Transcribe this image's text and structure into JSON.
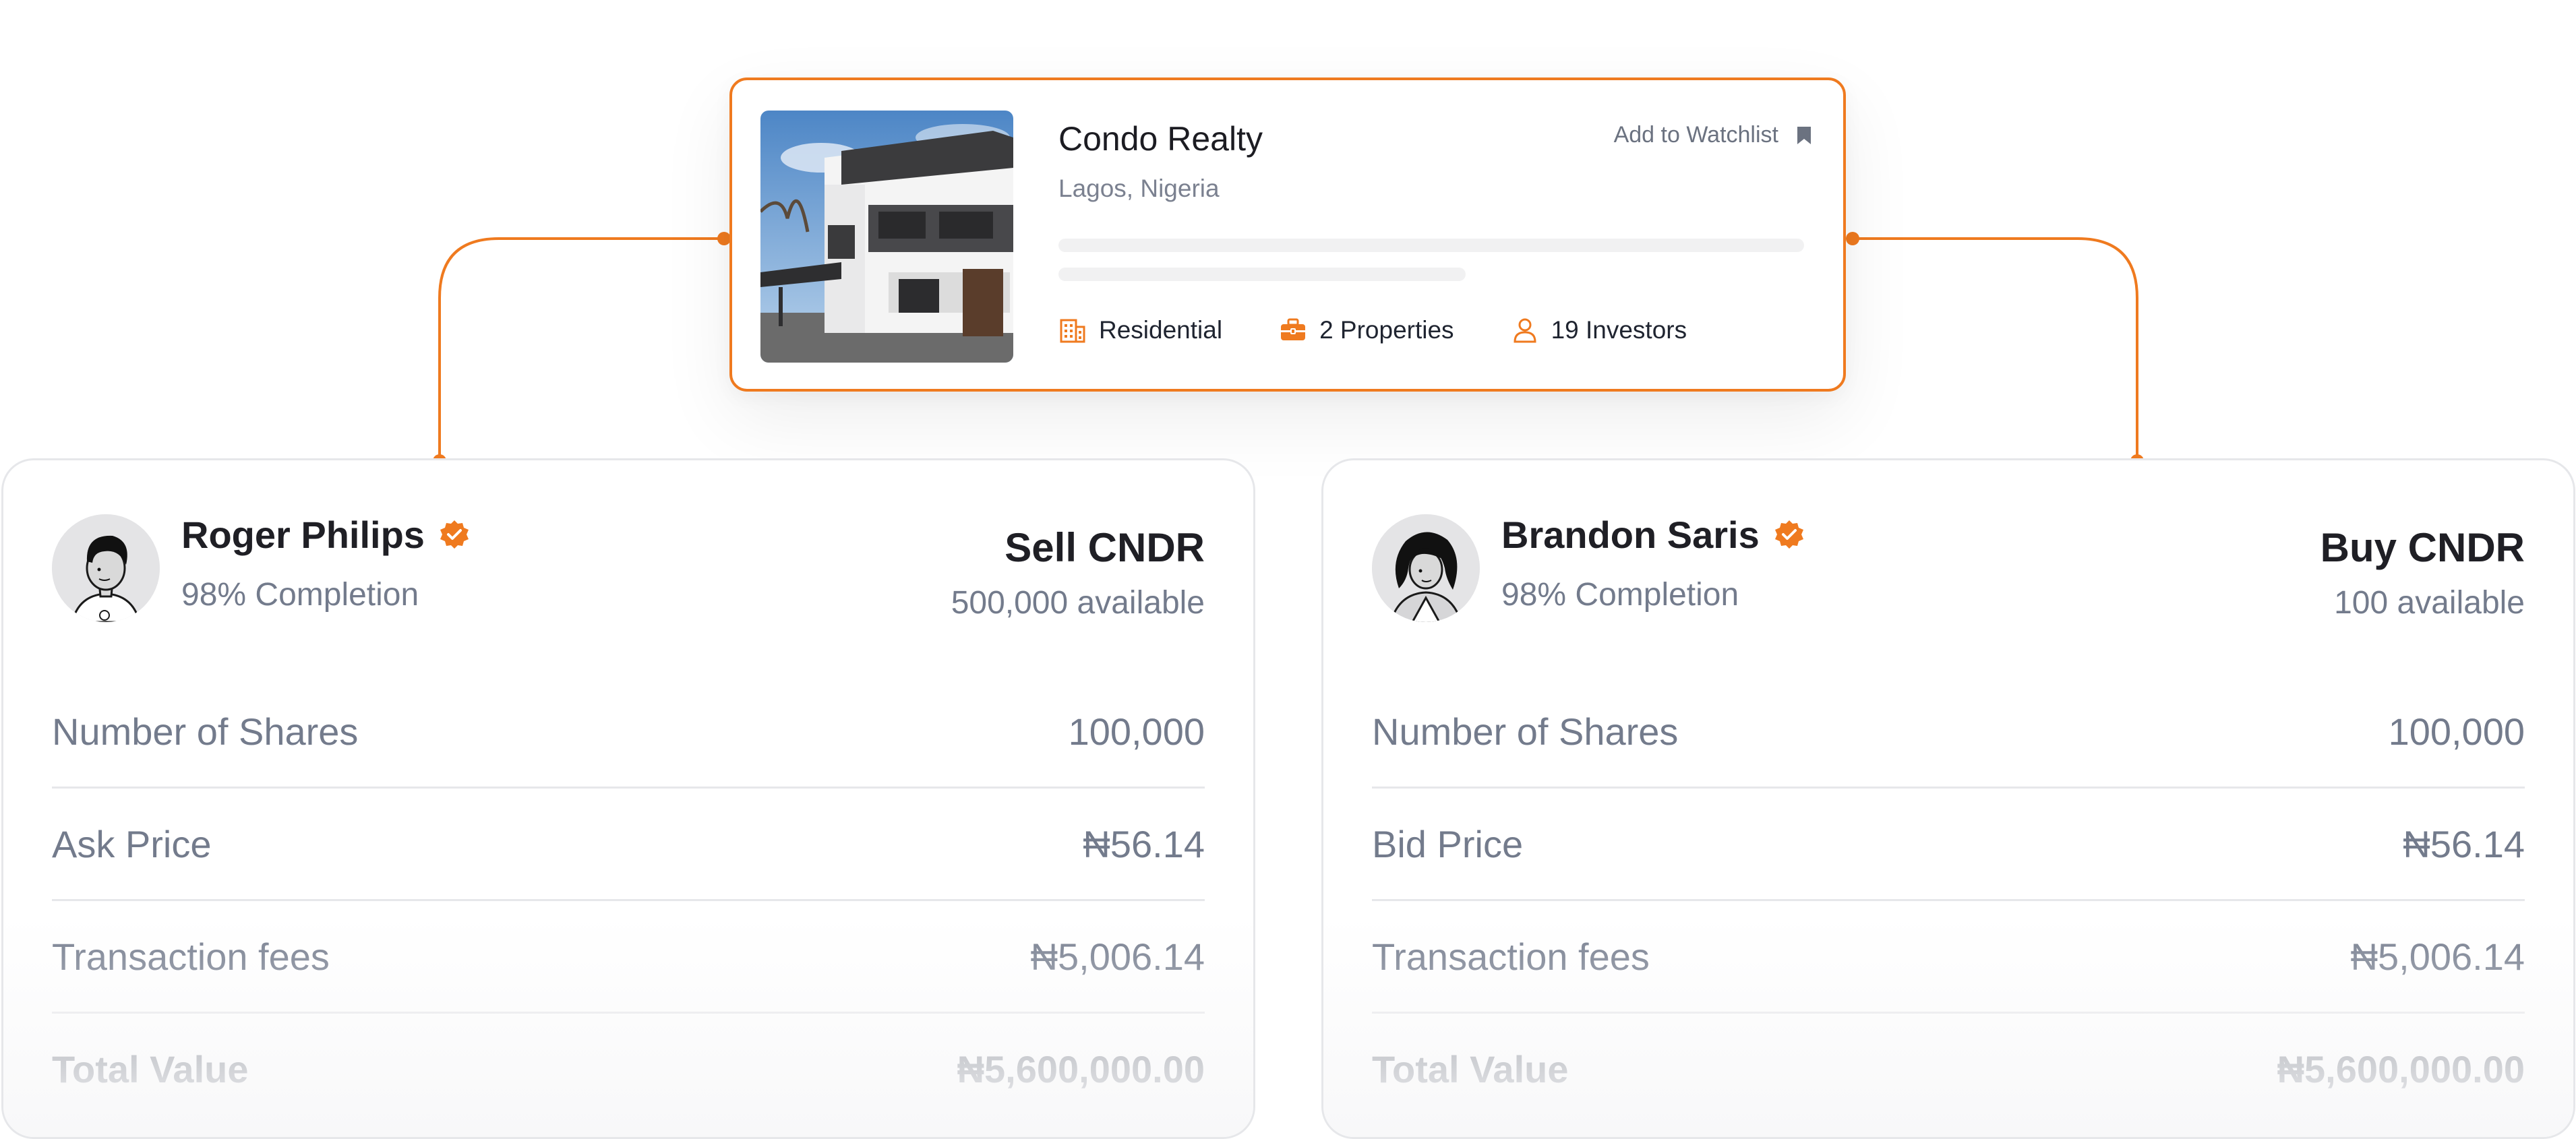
{
  "colors": {
    "accent": "#ef7a1f",
    "muted_text": "#737b8c",
    "border": "#e6e7ea"
  },
  "property": {
    "title": "Condo Realty",
    "location": "Lagos, Nigeria",
    "watchlist_label": "Add to Watchlist",
    "meta": [
      {
        "icon": "building-icon",
        "label": "Residential"
      },
      {
        "icon": "briefcase-icon",
        "label": "2 Properties"
      },
      {
        "icon": "person-icon",
        "label": "19 Investors"
      }
    ]
  },
  "sell": {
    "name": "Roger Philips",
    "completion": "98% Completion",
    "action": "Sell CNDR",
    "available": "500,000 available",
    "rows": [
      {
        "label": "Number of Shares",
        "value": "100,000"
      },
      {
        "label": "Ask Price",
        "value": "₦56.14"
      },
      {
        "label": "Transaction fees",
        "value": "₦5,006.14"
      },
      {
        "label": "Total Value",
        "value": "₦5,600,000.00"
      }
    ]
  },
  "buy": {
    "name": "Brandon Saris",
    "completion": "98% Completion",
    "action": "Buy CNDR",
    "available": "100 available",
    "rows": [
      {
        "label": "Number of Shares",
        "value": "100,000"
      },
      {
        "label": "Bid Price",
        "value": "₦56.14"
      },
      {
        "label": "Transaction fees",
        "value": "₦5,006.14"
      },
      {
        "label": "Total Value",
        "value": "₦5,600,000.00"
      }
    ]
  }
}
